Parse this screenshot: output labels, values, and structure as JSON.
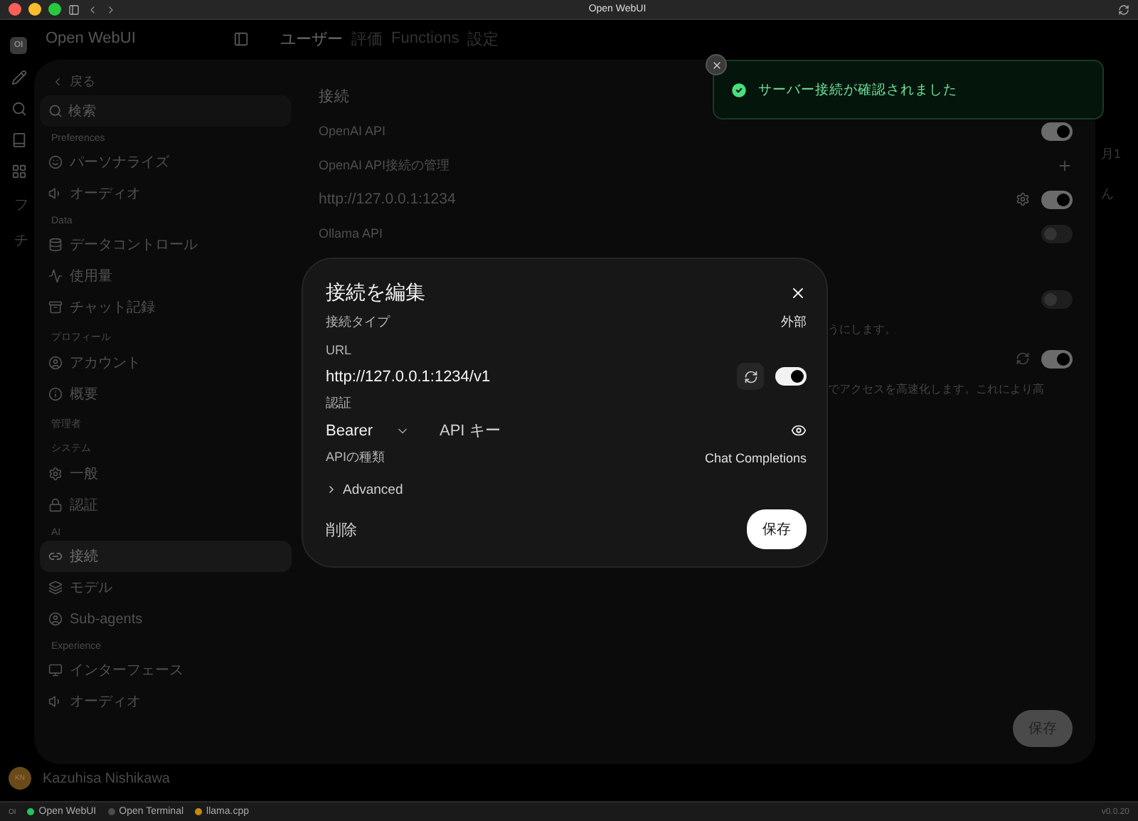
{
  "window": {
    "title": "Open WebUI"
  },
  "app": {
    "logo": "OI",
    "name": "Open WebUI",
    "rail_labels": [
      "フ",
      "チ"
    ],
    "nav": [
      {
        "label": "ユーザー",
        "selected": true
      },
      {
        "label": "評価",
        "selected": false
      },
      {
        "label": "Functions",
        "selected": false
      },
      {
        "label": "設定",
        "selected": false
      }
    ],
    "edge_fragments": [
      "月1",
      "ん"
    ],
    "user": {
      "initials": "KN",
      "name": "Kazuhisa Nishikawa"
    }
  },
  "settings": {
    "back": "戻る",
    "search": {
      "placeholder": "検索"
    },
    "sections": [
      {
        "title": "Preferences",
        "items": [
          {
            "label": "パーソナライズ",
            "selected": false
          },
          {
            "label": "オーディオ",
            "selected": false
          }
        ]
      },
      {
        "title": "Data",
        "items": [
          {
            "label": "データコントロール",
            "selected": false
          },
          {
            "label": "使用量",
            "selected": false
          },
          {
            "label": "チャット記録",
            "selected": false
          }
        ]
      },
      {
        "title": "プロフィール",
        "items": [
          {
            "label": "アカウント",
            "selected": false
          },
          {
            "label": "概要",
            "selected": false
          }
        ]
      },
      {
        "title": "管理者",
        "subtitle": "システム",
        "items": [
          {
            "label": "一般",
            "selected": false
          },
          {
            "label": "認証",
            "selected": false
          }
        ]
      },
      {
        "title": "AI",
        "items": [
          {
            "label": "接続",
            "selected": true
          },
          {
            "label": "モデル",
            "selected": false
          },
          {
            "label": "Sub-agents",
            "selected": false
          }
        ]
      },
      {
        "title": "Experience",
        "items": [
          {
            "label": "インターフェース",
            "selected": false
          },
          {
            "label": "オーディオ",
            "selected": false
          }
        ]
      }
    ],
    "content": {
      "heading": "接続",
      "rows": [
        {
          "kind": "toggle",
          "label": "OpenAI API",
          "on": true
        },
        {
          "kind": "add",
          "label": "OpenAI API接続の管理"
        },
        {
          "kind": "connection",
          "label": "http://127.0.0.1:1234",
          "on": true
        },
        {
          "kind": "toggle",
          "label": "Ollama API",
          "on": false
        },
        {
          "kind": "toggle",
          "on": false
        },
        {
          "kind": "text",
          "label": "うにします。"
        },
        {
          "kind": "sync",
          "on": true
        },
        {
          "kind": "text",
          "label": "でアクセスを高速化します。これにより高"
        }
      ]
    },
    "save": "保存"
  },
  "modal": {
    "title": "接続を編集",
    "fields": [
      {
        "kind": "pair",
        "label": "接続タイプ",
        "value": "外部"
      },
      {
        "kind": "url",
        "label": "URL",
        "value": "http://127.0.0.1:1234/v1",
        "on": true
      },
      {
        "kind": "auth",
        "label": "認証",
        "value": "Bearer",
        "placeholder": "API キー"
      },
      {
        "kind": "pair",
        "label": "APIの種類",
        "value": "Chat Completions"
      },
      {
        "kind": "expander",
        "label": "Advanced",
        "expanded": false
      }
    ],
    "delete": "削除",
    "save": "保存"
  },
  "toast": {
    "message": "サーバー接続が確認されました"
  },
  "status_bar": {
    "logo": "OI",
    "items": [
      {
        "label": "Open WebUI",
        "color": "#22c55e"
      },
      {
        "label": "Open Terminal",
        "color": "#4b4b4b"
      },
      {
        "label": "llama.cpp",
        "color": "#c58a12"
      }
    ],
    "version": "v0.0.20"
  }
}
